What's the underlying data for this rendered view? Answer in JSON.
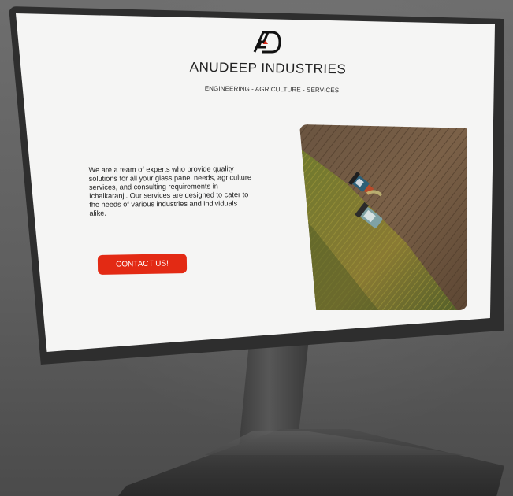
{
  "brand": {
    "logo_text": "AD",
    "title": "ANUDEEP INDUSTRIES",
    "tagline": "ENGINEERING - AGRICULTURE - SERVICES"
  },
  "hero": {
    "description": "We are a team of experts who provide quality solutions for all your glass panel needs, agriculture services, and consulting requirements in Ichalkaranji. Our services are designed to cater to the needs of various industries and individuals alike.",
    "cta_label": "CONTACT US!",
    "image_icon": "aerial-harvest-field-photo"
  },
  "colors": {
    "accent": "#e32a14",
    "screen_background": "#f5f5f4",
    "bezel": "#2e2e2e"
  }
}
